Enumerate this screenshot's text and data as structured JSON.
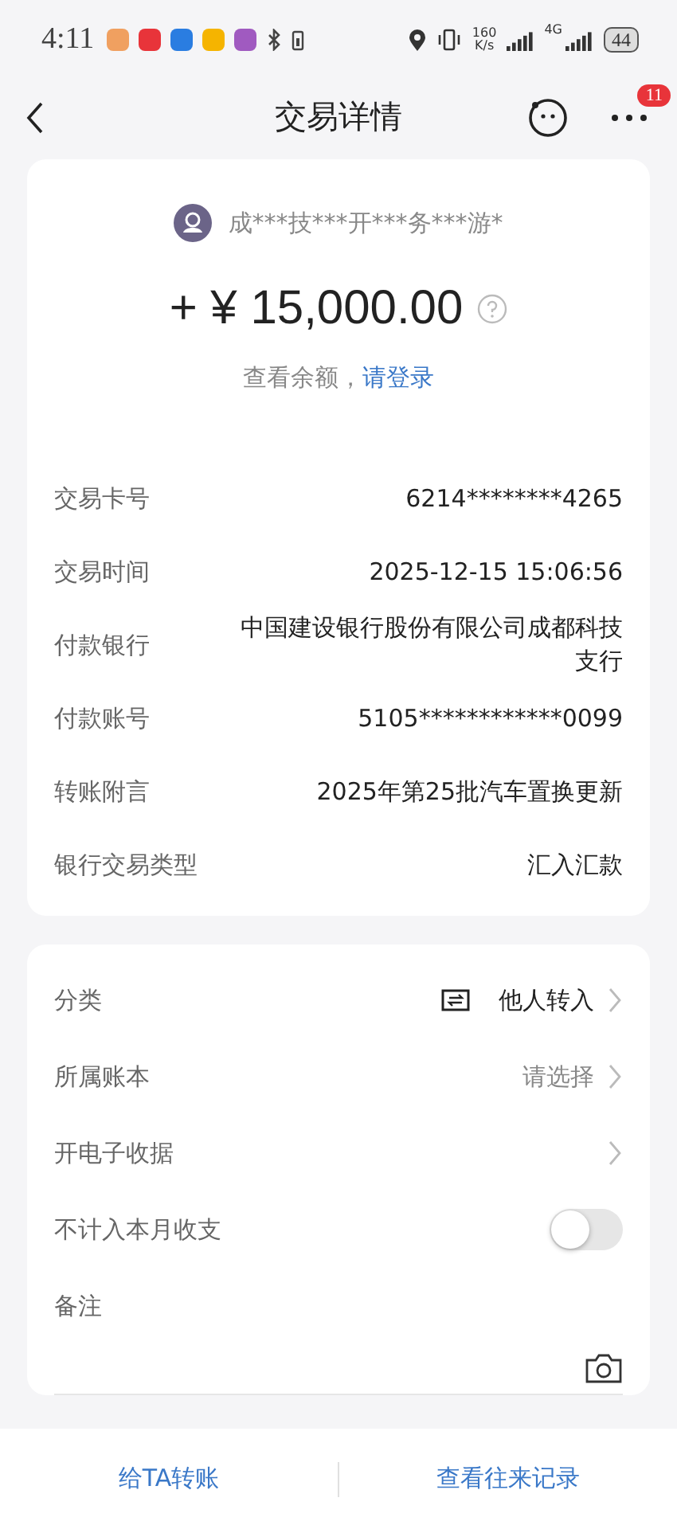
{
  "status_bar": {
    "time": "4:11",
    "speed_value": "160",
    "speed_unit": "K/s",
    "network_type": "4G",
    "battery": "44"
  },
  "header": {
    "title": "交易详情",
    "badge": "11"
  },
  "payer": {
    "name": "成***技***开***务***游*"
  },
  "amount": "+ ¥ 15,000.00",
  "balance_prompt": {
    "text": "查看余额，",
    "link": "请登录"
  },
  "details": [
    {
      "label": "交易卡号",
      "value": "6214********4265"
    },
    {
      "label": "交易时间",
      "value": "2025-12-15 15:06:56"
    },
    {
      "label": "付款银行",
      "value": "中国建设银行股份有限公司成都科技支行"
    },
    {
      "label": "付款账号",
      "value": "5105************0099"
    },
    {
      "label": "转账附言",
      "value": "2025年第25批汽车置换更新"
    },
    {
      "label": "银行交易类型",
      "value": "汇入汇款"
    }
  ],
  "settings": [
    {
      "kind": "category",
      "label": "分类",
      "value": "他人转入"
    },
    {
      "kind": "select",
      "label": "所属账本",
      "value": "请选择"
    },
    {
      "kind": "link",
      "label": "开电子收据"
    },
    {
      "kind": "toggle",
      "label": "不计入本月收支",
      "on": false
    },
    {
      "kind": "note",
      "label": "备注"
    }
  ],
  "bottom_actions": [
    "给TA转账",
    "查看往来记录"
  ]
}
